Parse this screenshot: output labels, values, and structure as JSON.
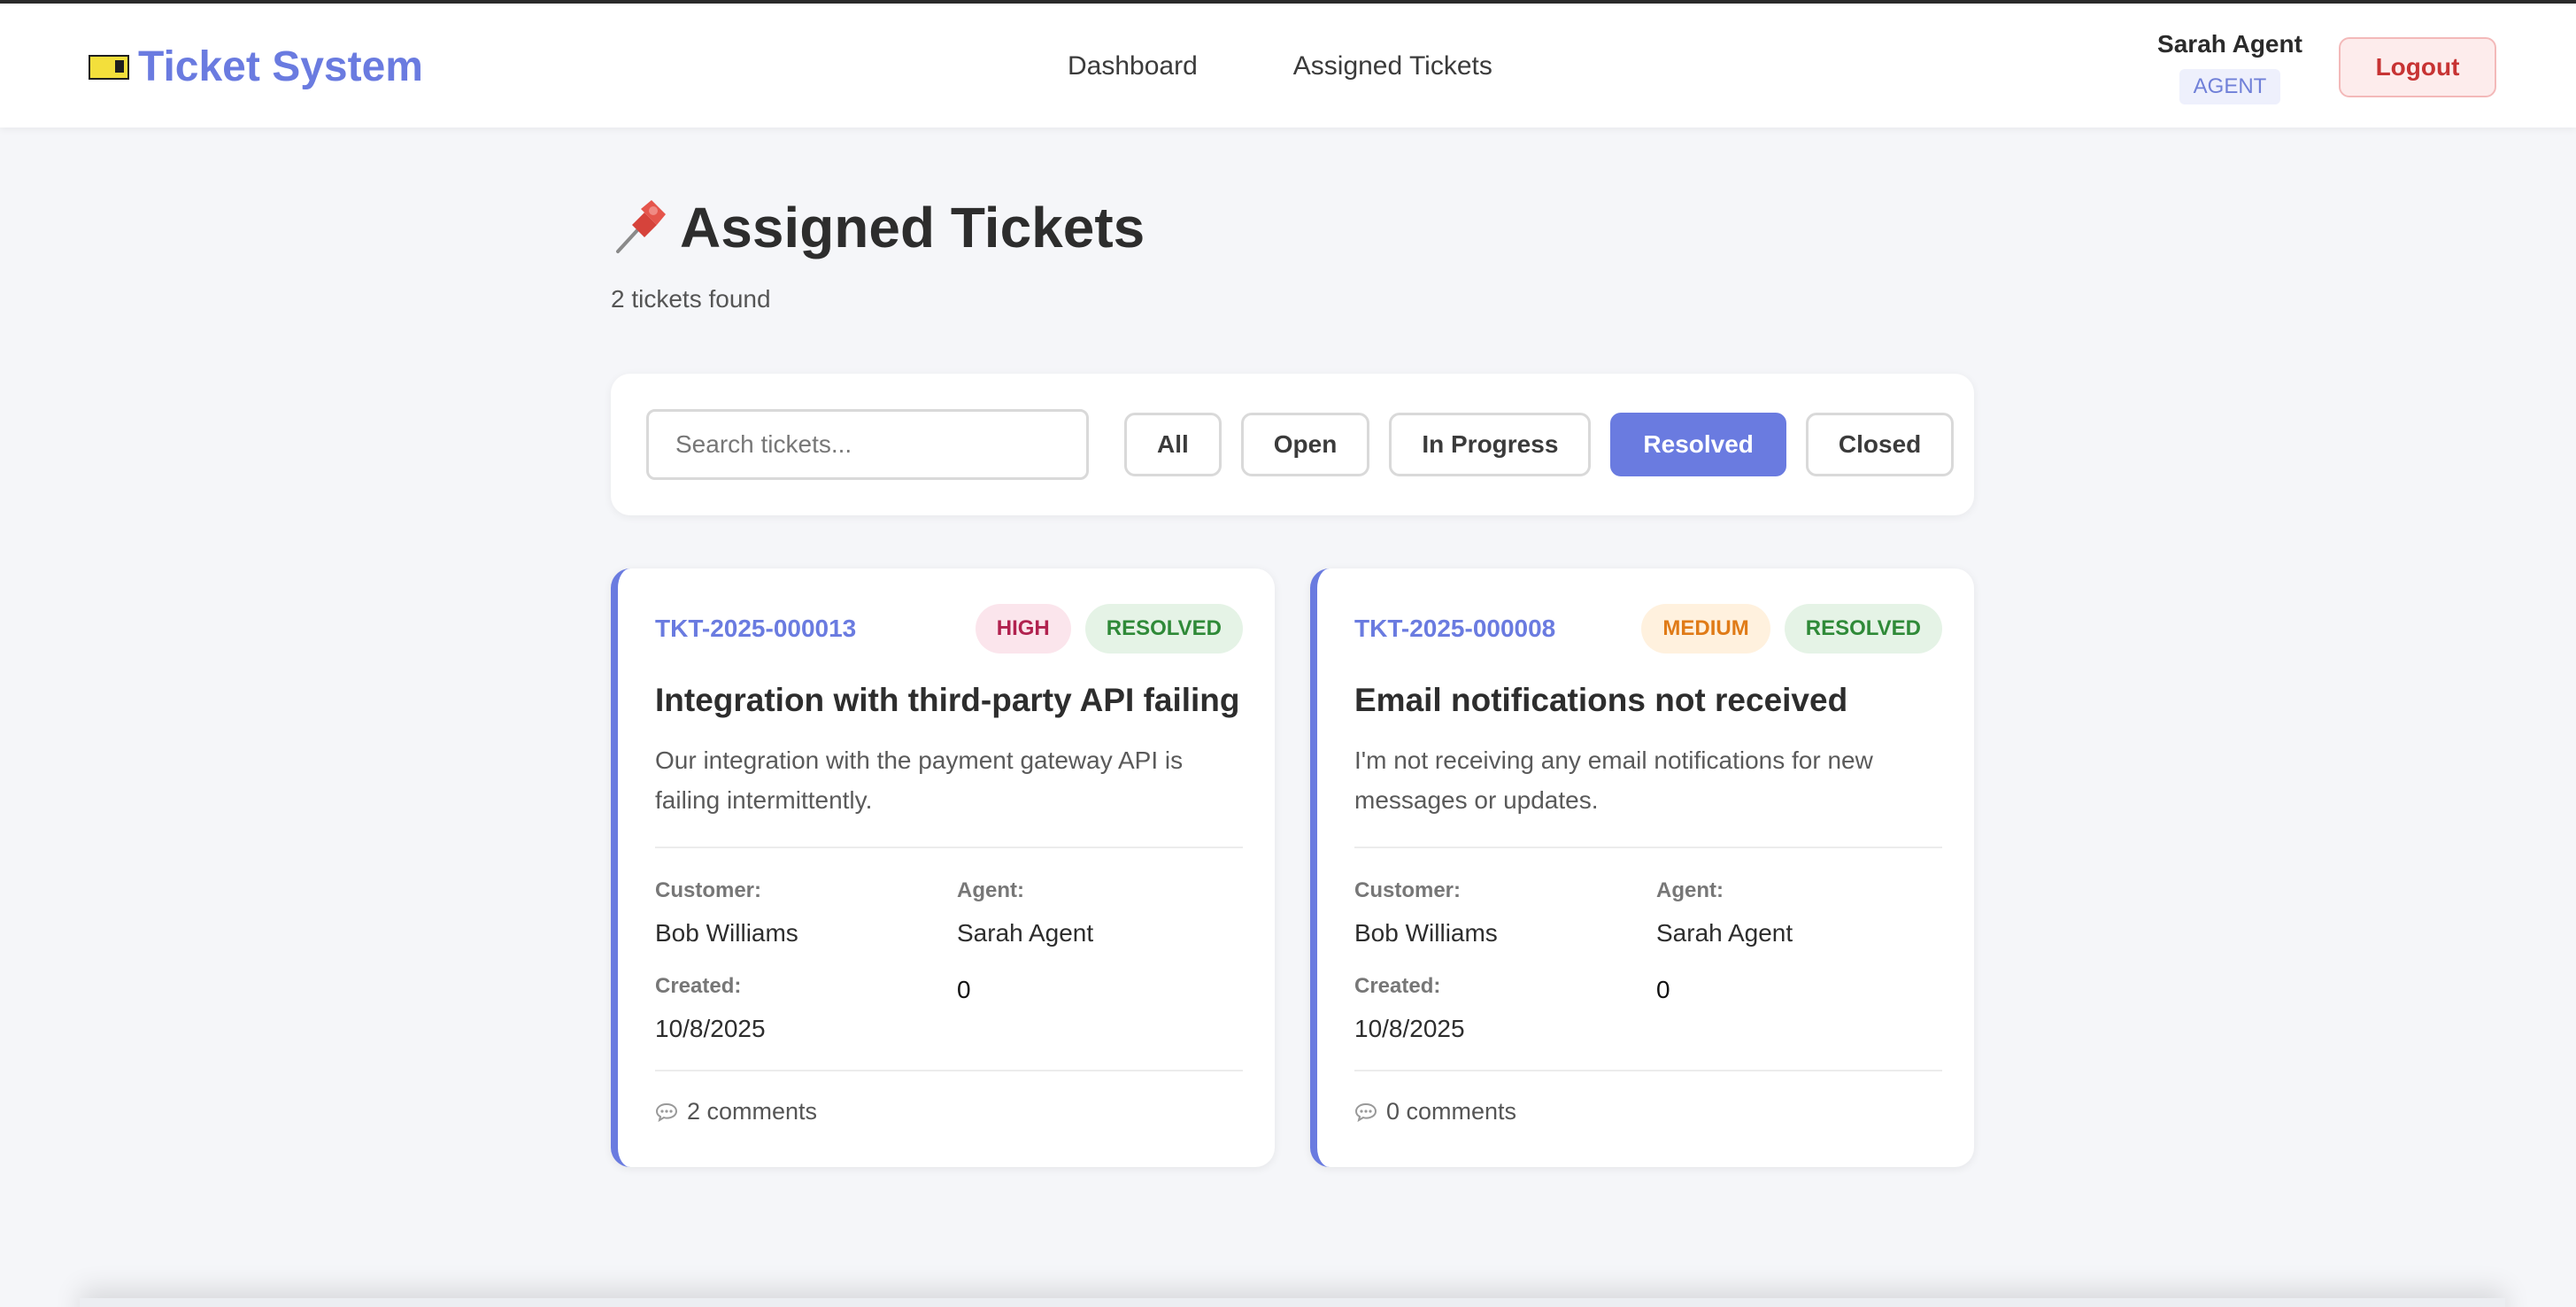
{
  "nav": {
    "brand": "Ticket System",
    "links": [
      "Dashboard",
      "Assigned Tickets"
    ],
    "user_name": "Sarah Agent",
    "user_role": "AGENT",
    "logout_label": "Logout"
  },
  "page": {
    "title": "Assigned Tickets",
    "count_text": "2 tickets found"
  },
  "filters": {
    "search_placeholder": "Search tickets...",
    "search_value": "",
    "buttons": [
      "All",
      "Open",
      "In Progress",
      "Resolved",
      "Closed"
    ],
    "active": "Resolved"
  },
  "tickets": [
    {
      "id": "TKT-2025-000013",
      "priority": "HIGH",
      "status": "RESOLVED",
      "title": "Integration with third-party API failing",
      "description": "Our integration with the payment gateway API is failing intermittently.",
      "customer_label": "Customer:",
      "customer": "Bob Williams",
      "agent_label": "Agent:",
      "agent": "Sarah Agent",
      "created_label": "Created:",
      "created": "10/8/2025",
      "extra_value": "0",
      "comments": "2 comments"
    },
    {
      "id": "TKT-2025-000008",
      "priority": "MEDIUM",
      "status": "RESOLVED",
      "title": "Email notifications not received",
      "description": "I'm not receiving any email notifications for new messages or updates.",
      "customer_label": "Customer:",
      "customer": "Bob Williams",
      "agent_label": "Agent:",
      "agent": "Sarah Agent",
      "created_label": "Created:",
      "created": "10/8/2025",
      "extra_value": "0",
      "comments": "0 comments"
    }
  ],
  "colors": {
    "accent": "#6a7be0",
    "high": "#b1224f",
    "medium": "#e07b17",
    "resolved": "#2f8a38",
    "logout": "#c73333"
  },
  "icons": {
    "brand": "ticket-icon",
    "title": "pushpin-icon",
    "comments": "speech-bubble-icon"
  }
}
